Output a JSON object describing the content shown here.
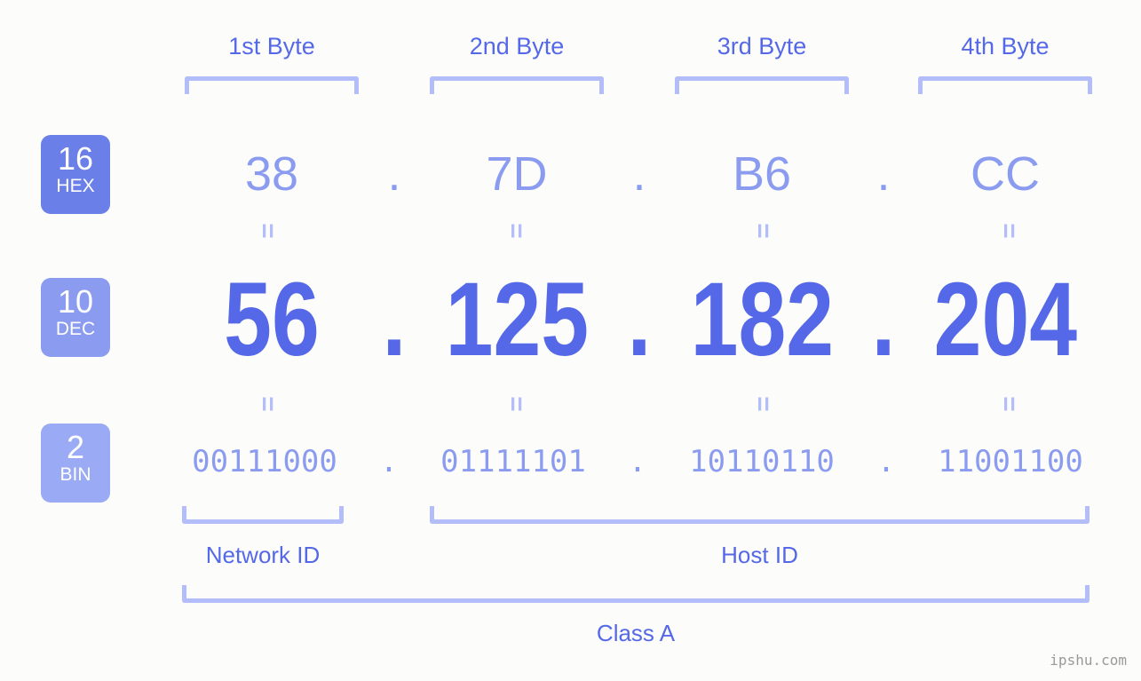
{
  "background_color": "#fcfdfa",
  "accent_color": "#5568e8",
  "light_accent_color": "#8b9cf0",
  "bracket_color": "#b3bdfa",
  "byte_headers": [
    {
      "label": "1st Byte"
    },
    {
      "label": "2nd Byte"
    },
    {
      "label": "3rd Byte"
    },
    {
      "label": "4th Byte"
    }
  ],
  "rows": {
    "hex": {
      "radix": "16",
      "radix_name": "HEX",
      "badge_color": "#6b7fe8",
      "values": [
        "38",
        "7D",
        "B6",
        "CC"
      ],
      "separator": "."
    },
    "dec": {
      "radix": "10",
      "radix_name": "DEC",
      "badge_color": "#8b9cf0",
      "values": [
        "56",
        "125",
        "182",
        "204"
      ],
      "separator": "."
    },
    "bin": {
      "radix": "2",
      "radix_name": "BIN",
      "badge_color": "#9aaaf5",
      "values": [
        "00111000",
        "01111101",
        "10110110",
        "11001100"
      ],
      "separator": "."
    }
  },
  "equals_marker": "=",
  "sections": {
    "network_id": "Network ID",
    "host_id": "Host ID",
    "class": "Class A"
  },
  "watermark": "ipshu.com"
}
